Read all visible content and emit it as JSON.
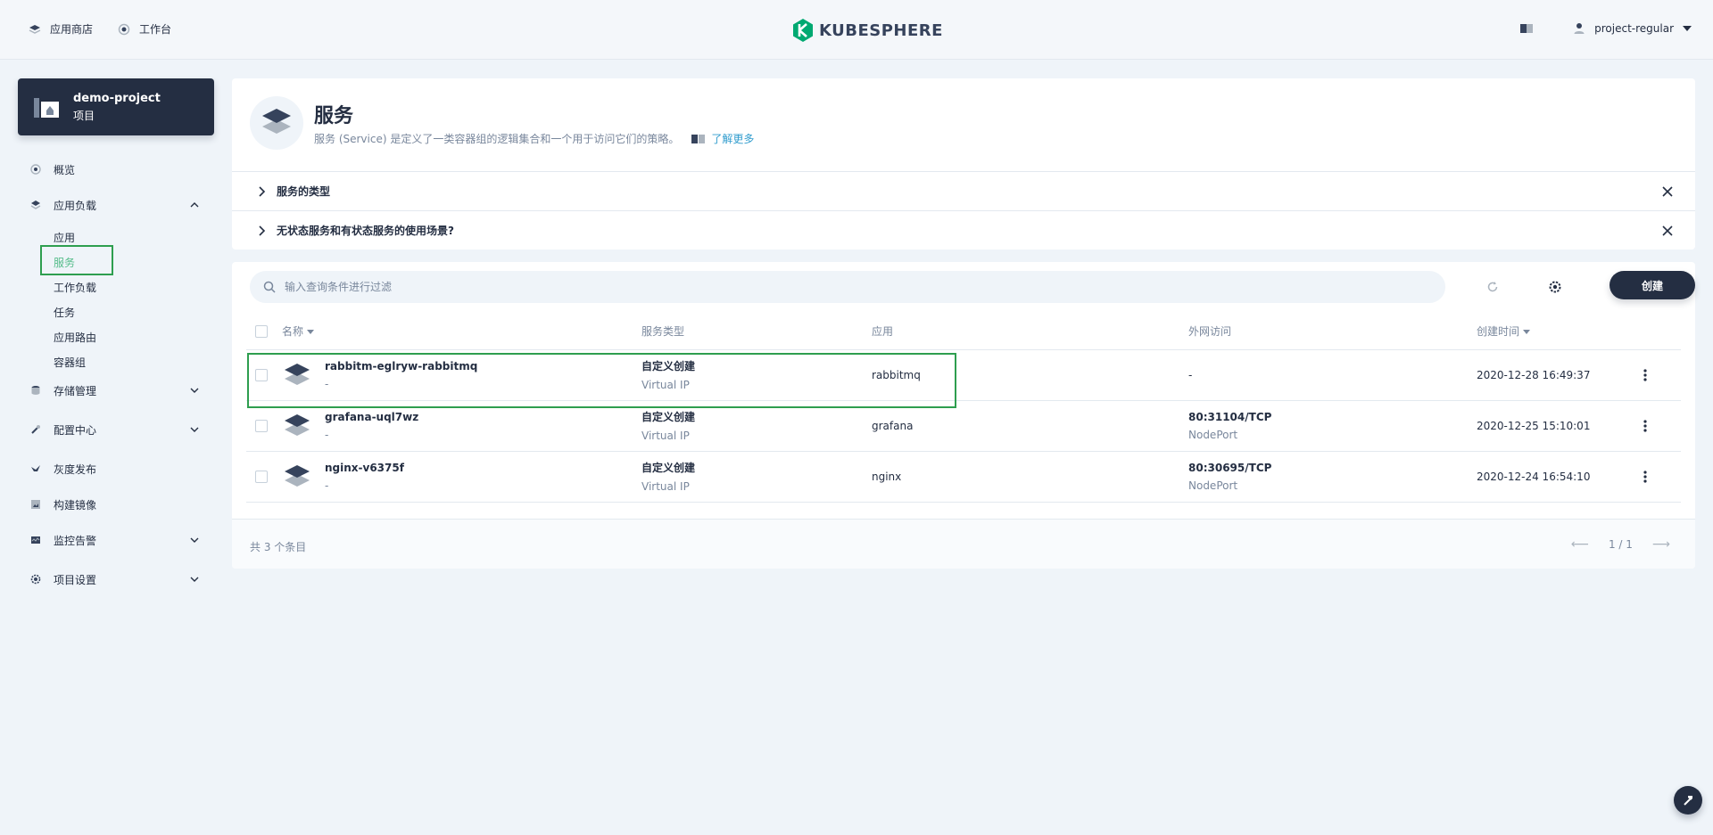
{
  "header": {
    "nav": [
      {
        "label": "应用商店",
        "icon": "appstore-icon"
      },
      {
        "label": "工作台",
        "icon": "dashboard-icon"
      }
    ],
    "logo_text": "KUBESPHERE",
    "user": "project-regular"
  },
  "project": {
    "name": "demo-project",
    "type": "项目"
  },
  "sidebar": {
    "overview": "概览",
    "workloads_group": "应用负载",
    "workloads_items": [
      "应用",
      "服务",
      "工作负载",
      "任务",
      "应用路由",
      "容器组"
    ],
    "storage": "存储管理",
    "config": "配置中心",
    "grayscale": "灰度发布",
    "image_builder": "构建镜像",
    "monitoring": "监控告警",
    "settings": "项目设置",
    "active_item": "服务"
  },
  "page": {
    "title": "服务",
    "description": "服务 (Service) 是定义了一类容器组的逻辑集合和一个用于访问它们的策略。",
    "learn_more": "了解更多",
    "faq": [
      "服务的类型",
      "无状态服务和有状态服务的使用场景?"
    ]
  },
  "toolbar": {
    "search_placeholder": "输入查询条件进行过滤",
    "create_label": "创建"
  },
  "table": {
    "columns": [
      "名称",
      "服务类型",
      "应用",
      "外网访问",
      "创建时间"
    ],
    "rows": [
      {
        "name": "rabbitm-eglryw-rabbitmq",
        "desc": "-",
        "type": "自定义创建",
        "type_sub": "Virtual IP",
        "app": "rabbitmq",
        "access": "-",
        "access_sub": "",
        "created": "2020-12-28 16:49:37"
      },
      {
        "name": "grafana-uql7wz",
        "desc": "-",
        "type": "自定义创建",
        "type_sub": "Virtual IP",
        "app": "grafana",
        "access": "80:31104/TCP",
        "access_sub": "NodePort",
        "created": "2020-12-25 15:10:01"
      },
      {
        "name": "nginx-v6375f",
        "desc": "-",
        "type": "自定义创建",
        "type_sub": "Virtual IP",
        "app": "nginx",
        "access": "80:30695/TCP",
        "access_sub": "NodePort",
        "created": "2020-12-24 16:54:10"
      }
    ]
  },
  "footer": {
    "total": "共 3 个条目",
    "page": "1 / 1"
  },
  "colors": {
    "brand": "#242e42",
    "accent": "#55bc8a",
    "highlight": "#2e9e4f",
    "link": "#329dce"
  }
}
